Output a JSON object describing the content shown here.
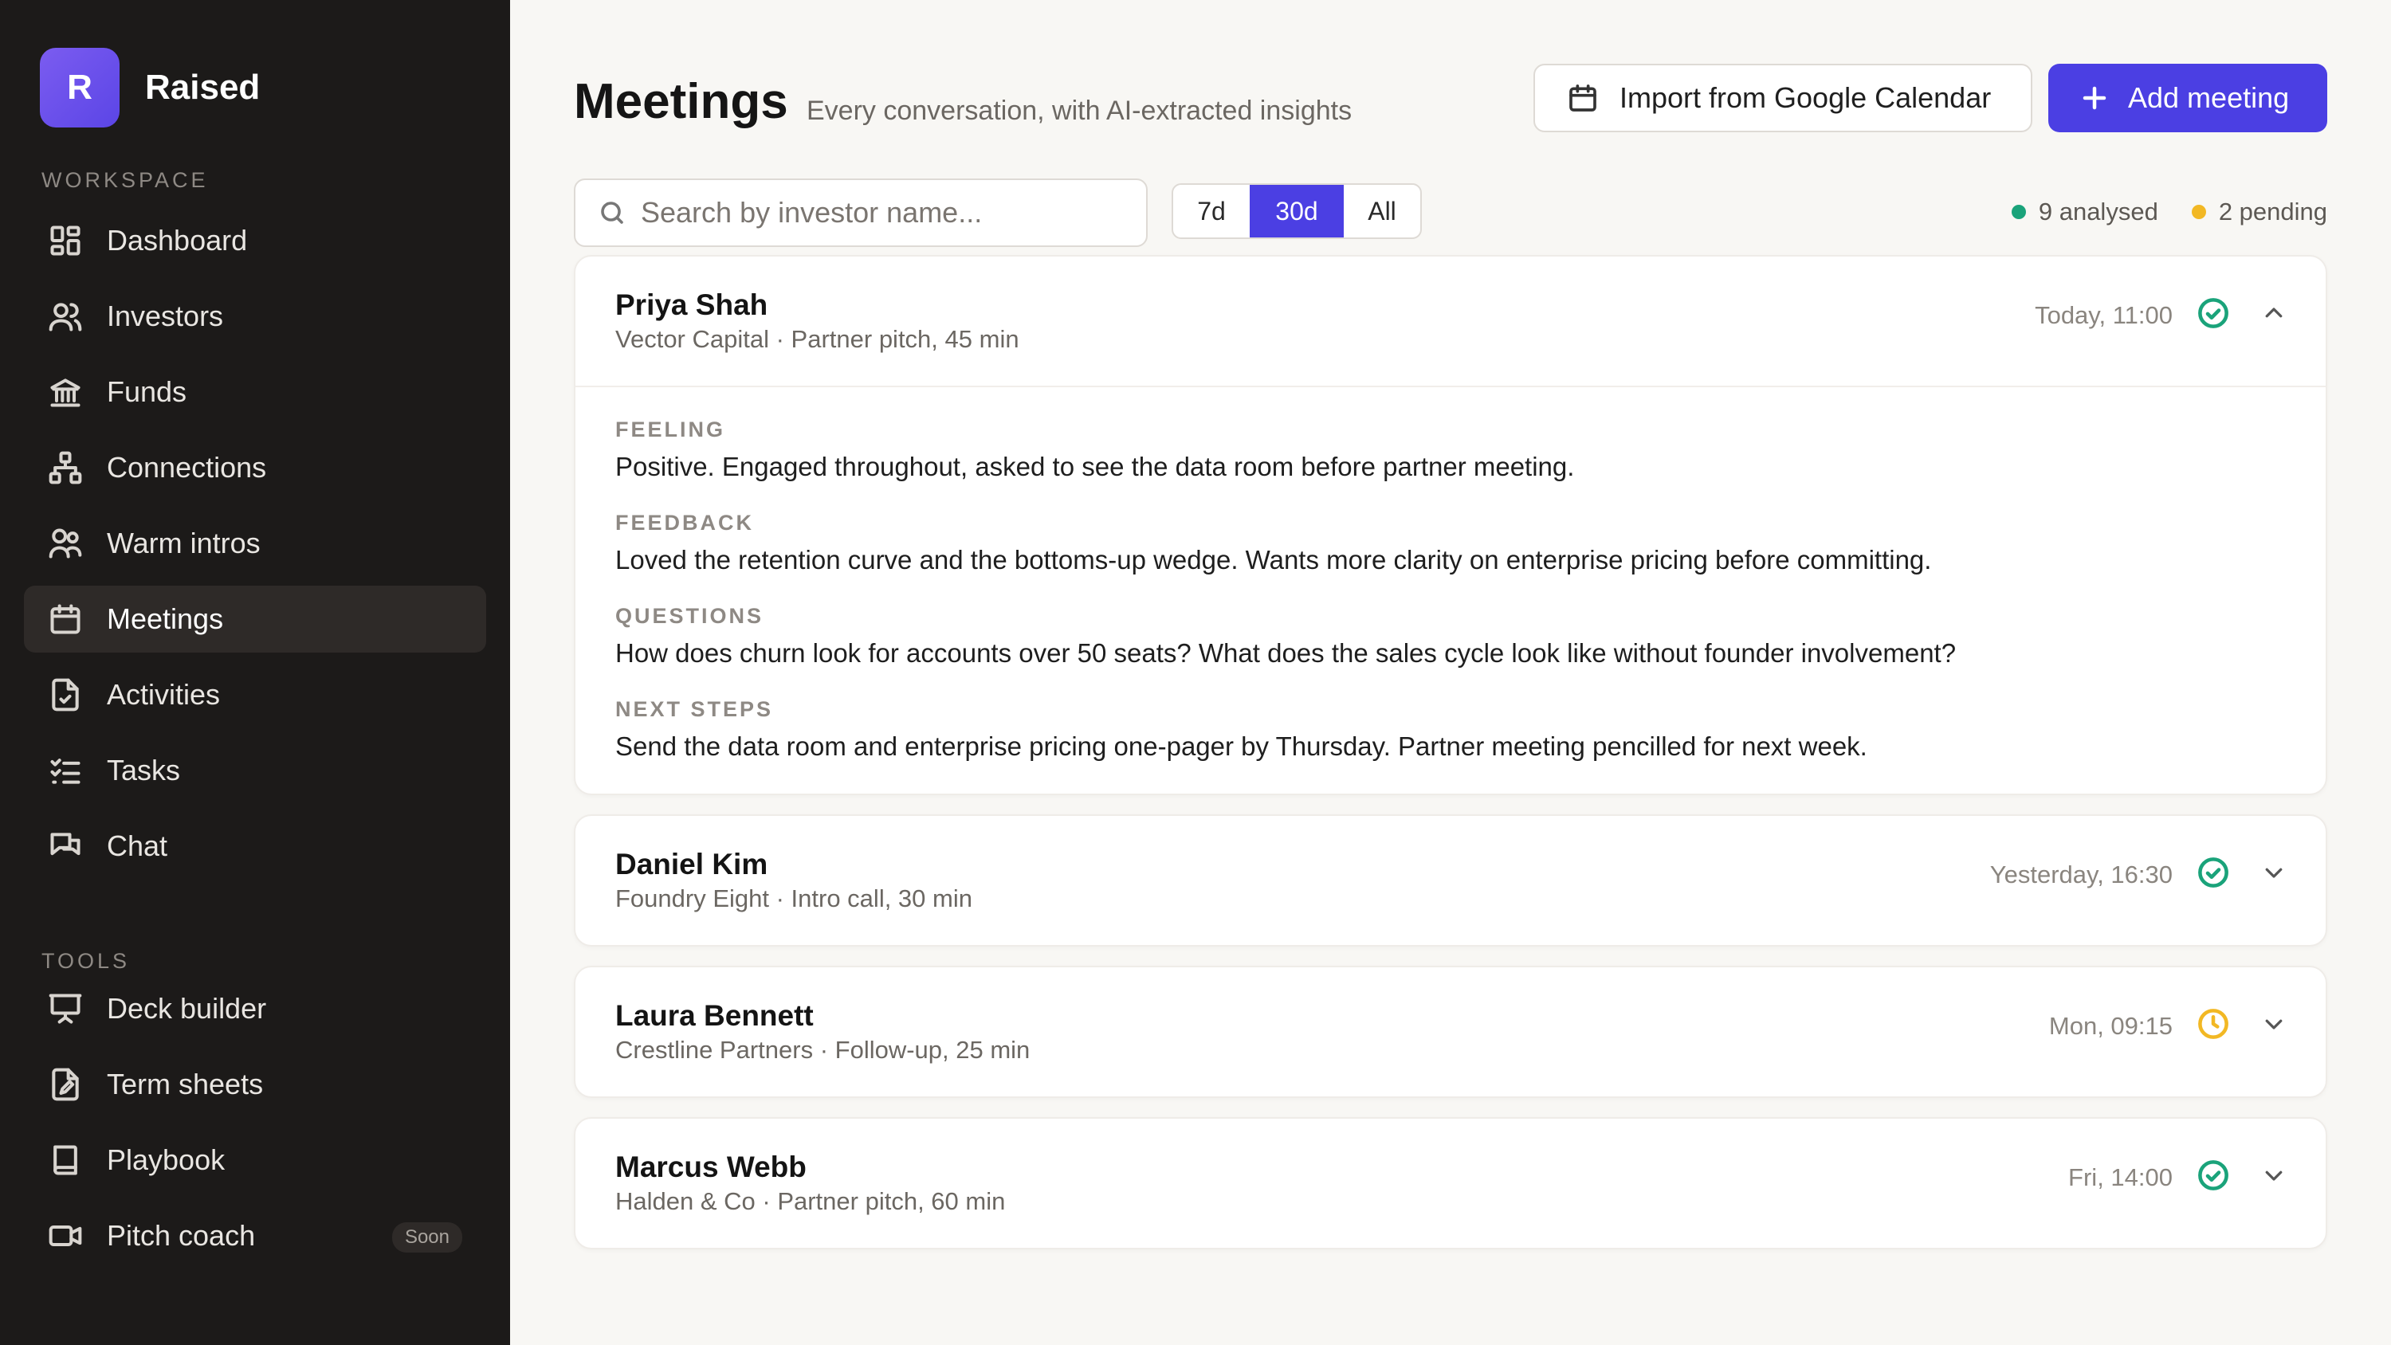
{
  "brand": {
    "initial": "R",
    "name": "Raised",
    "gradient": [
      "#7b5cf0",
      "#5b45e6"
    ]
  },
  "sidebar": {
    "workspace_label": "WORKSPACE",
    "tools_label": "TOOLS",
    "workspace_items": [
      {
        "label": "Dashboard",
        "icon": "dashboard-icon"
      },
      {
        "label": "Investors",
        "icon": "users-icon"
      },
      {
        "label": "Funds",
        "icon": "bank-icon"
      },
      {
        "label": "Connections",
        "icon": "network-icon"
      },
      {
        "label": "Warm intros",
        "icon": "intros-icon"
      },
      {
        "label": "Meetings",
        "icon": "calendar-icon",
        "active": true
      },
      {
        "label": "Activities",
        "icon": "file-check-icon"
      },
      {
        "label": "Tasks",
        "icon": "checklist-icon"
      },
      {
        "label": "Chat",
        "icon": "chat-icon"
      }
    ],
    "tool_items": [
      {
        "label": "Deck builder",
        "icon": "presentation-icon"
      },
      {
        "label": "Term sheets",
        "icon": "file-edit-icon"
      },
      {
        "label": "Playbook",
        "icon": "book-icon"
      },
      {
        "label": "Pitch coach",
        "icon": "video-icon",
        "badge": "Soon"
      }
    ]
  },
  "header": {
    "title": "Meetings",
    "subtitle": "Every conversation, with AI-extracted insights",
    "import_label": "Import from Google Calendar",
    "add_label": "Add meeting"
  },
  "toolbar": {
    "search_placeholder": "Search by investor name...",
    "ranges": [
      "7d",
      "30d",
      "All"
    ],
    "active_range": "30d",
    "analysed": "9 analysed",
    "pending": "2 pending"
  },
  "colors": {
    "accent": "#4b3fe3",
    "analysed": "#1aa37a",
    "pending": "#f2b824",
    "sidebar": "#1c1a19"
  },
  "meetings": [
    {
      "name": "Priya Shah",
      "meta": "Vector Capital · Partner pitch, 45 min",
      "time": "Today, 11:00",
      "status": "analysed",
      "expanded": true,
      "insights": [
        {
          "label": "FEELING",
          "text": "Positive. Engaged throughout, asked to see the data room before partner meeting."
        },
        {
          "label": "FEEDBACK",
          "text": "Loved the retention curve and the bottoms-up wedge. Wants more clarity on enterprise pricing before committing."
        },
        {
          "label": "QUESTIONS",
          "text": "How does churn look for accounts over 50 seats? What does the sales cycle look like without founder involvement?"
        },
        {
          "label": "NEXT STEPS",
          "text": "Send the data room and enterprise pricing one-pager by Thursday. Partner meeting pencilled for next week."
        }
      ]
    },
    {
      "name": "Daniel Kim",
      "meta": "Foundry Eight · Intro call, 30 min",
      "time": "Yesterday, 16:30",
      "status": "analysed"
    },
    {
      "name": "Laura Bennett",
      "meta": "Crestline Partners · Follow-up, 25 min",
      "time": "Mon, 09:15",
      "status": "pending"
    },
    {
      "name": "Marcus Webb",
      "meta": "Halden & Co · Partner pitch, 60 min",
      "time": "Fri, 14:00",
      "status": "analysed"
    }
  ]
}
